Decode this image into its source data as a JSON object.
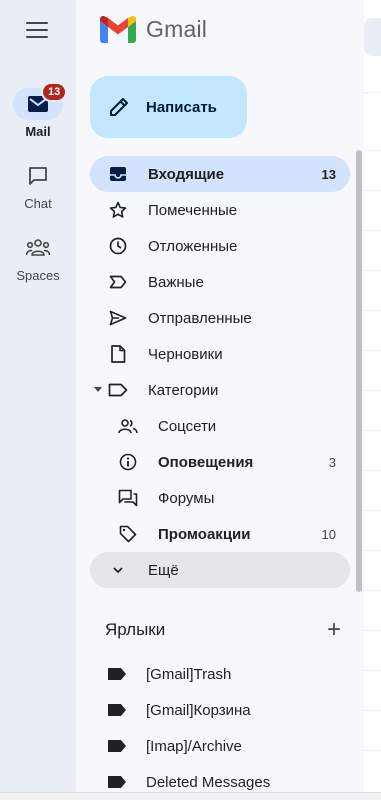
{
  "app": {
    "name": "Gmail",
    "menu_icon": "hamburger-menu-icon"
  },
  "rail": {
    "mail": {
      "label": "Mail",
      "badge": "13",
      "icon": "mail-icon"
    },
    "chat": {
      "label": "Chat",
      "icon": "chat-icon"
    },
    "spaces": {
      "label": "Spaces",
      "icon": "spaces-icon"
    }
  },
  "compose": {
    "label": "Написать",
    "icon": "pencil-icon"
  },
  "nav": {
    "inbox": {
      "label": "Входящие",
      "count": "13",
      "icon": "inbox-icon"
    },
    "starred": {
      "label": "Помеченные",
      "icon": "star-icon"
    },
    "snoozed": {
      "label": "Отложенные",
      "icon": "clock-icon"
    },
    "important": {
      "label": "Важные",
      "icon": "important-icon"
    },
    "sent": {
      "label": "Отправленные",
      "icon": "send-icon"
    },
    "drafts": {
      "label": "Черновики",
      "icon": "draft-icon"
    },
    "categories": {
      "label": "Категории",
      "icon": "label-outline-icon"
    },
    "social": {
      "label": "Соцсети",
      "icon": "people-icon"
    },
    "updates": {
      "label": "Оповещения",
      "count": "3",
      "icon": "info-icon"
    },
    "forums": {
      "label": "Форумы",
      "icon": "forum-icon"
    },
    "promotions": {
      "label": "Промоакции",
      "count": "10",
      "icon": "tag-icon"
    },
    "more": {
      "label": "Ещё",
      "icon": "chevron-down-icon"
    }
  },
  "labels": {
    "title": "Ярлыки",
    "add_icon": "plus-icon",
    "items": [
      {
        "label": "[Gmail]Trash"
      },
      {
        "label": "[Gmail]Корзина"
      },
      {
        "label": "[Imap]/Archive"
      },
      {
        "label": "Deleted Messages"
      }
    ]
  },
  "colors": {
    "rail_bg": "#e9eef6",
    "active_bg": "#d3e3fd",
    "compose_bg": "#c2e7ff",
    "badge": "#b3261e"
  }
}
